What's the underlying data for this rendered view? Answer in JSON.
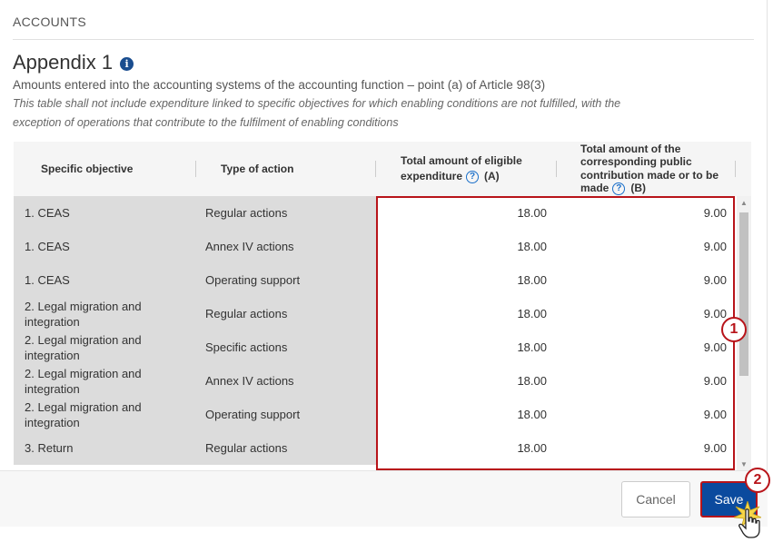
{
  "section": {
    "label": "ACCOUNTS"
  },
  "appendix": {
    "title": "Appendix 1",
    "subtitle": "Amounts entered into the accounting systems of the accounting function – point (a) of Article 98(3)",
    "note": "This table shall not include expenditure linked to specific objectives for which enabling conditions are not fulfilled, with the exception of operations that contribute to the fulfilment of enabling conditions"
  },
  "table": {
    "headers": {
      "objective": "Specific objective",
      "type": "Type of action",
      "a_text": "Total amount of eligible expenditure",
      "a_suffix": "(A)",
      "b_text": "Total amount of the corresponding public contribution made or to be made",
      "b_suffix": "(B)"
    },
    "rows": [
      {
        "objective": "1. CEAS",
        "type": "Regular actions",
        "a": "18.00",
        "b": "9.00"
      },
      {
        "objective": "1. CEAS",
        "type": "Annex IV actions",
        "a": "18.00",
        "b": "9.00"
      },
      {
        "objective": "1. CEAS",
        "type": "Operating support",
        "a": "18.00",
        "b": "9.00"
      },
      {
        "objective": "2. Legal migration and integration",
        "type": "Regular actions",
        "a": "18.00",
        "b": "9.00"
      },
      {
        "objective": "2. Legal migration and integration",
        "type": "Specific actions",
        "a": "18.00",
        "b": "9.00"
      },
      {
        "objective": "2. Legal migration and integration",
        "type": "Annex IV actions",
        "a": "18.00",
        "b": "9.00"
      },
      {
        "objective": "2. Legal migration and integration",
        "type": "Operating support",
        "a": "18.00",
        "b": "9.00"
      },
      {
        "objective": "3. Return",
        "type": "Regular actions",
        "a": "18.00",
        "b": "9.00"
      }
    ]
  },
  "callouts": {
    "one": "1",
    "two": "2"
  },
  "footer": {
    "cancel_label": "Cancel",
    "save_label": "Save"
  },
  "colors": {
    "primary": "#0b4a9e",
    "highlight": "#b8141a",
    "info": "#1a4d8f"
  },
  "icons": {
    "info": "info-icon",
    "help": "help-icon",
    "cursor": "hand-pointer-icon"
  }
}
